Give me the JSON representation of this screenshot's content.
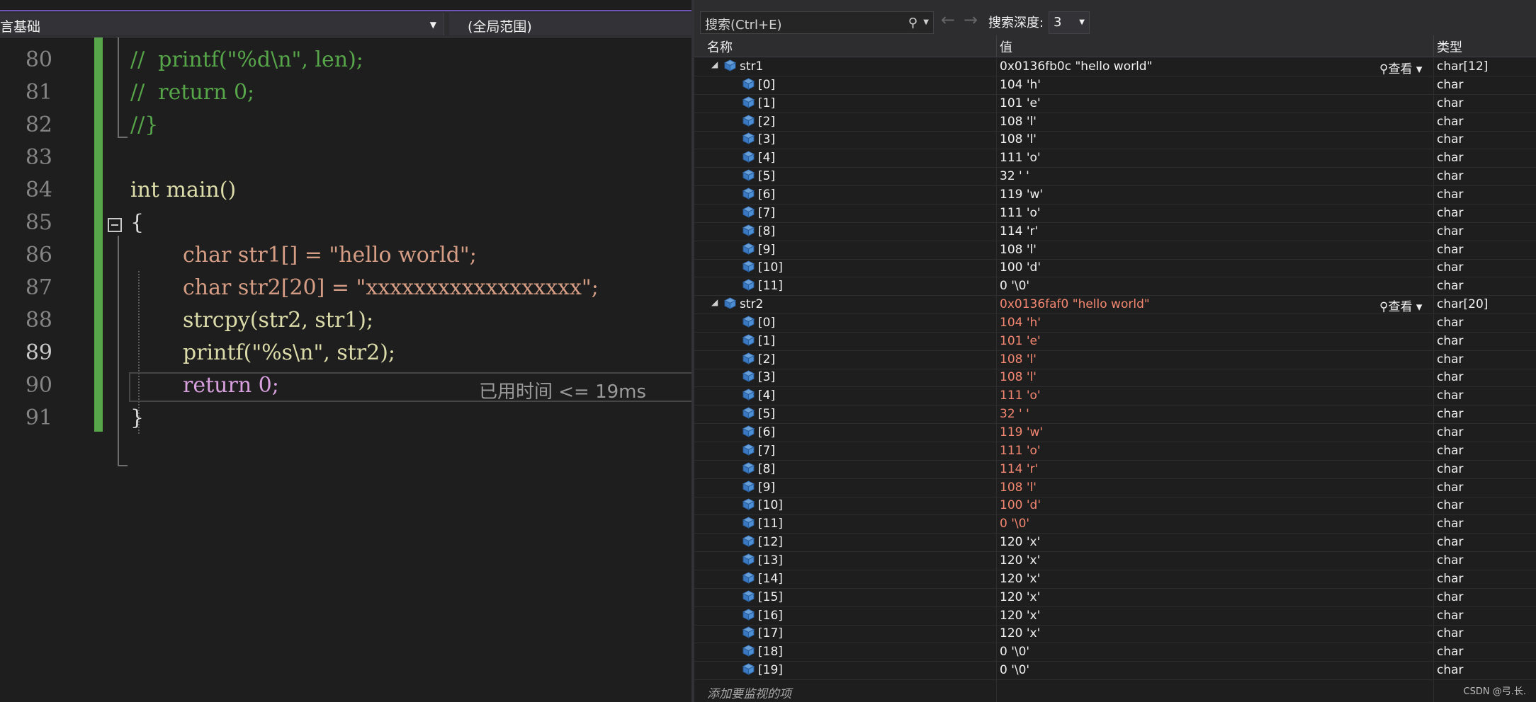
{
  "navbar": {
    "project": "言基础",
    "scope": "(全局范围)"
  },
  "editor": {
    "lines": [
      {
        "num": "80",
        "code": "//  printf(\"%d\\n\", len);"
      },
      {
        "num": "81",
        "code": "//  return 0;"
      },
      {
        "num": "82",
        "code": "//}"
      },
      {
        "num": "83",
        "code": ""
      },
      {
        "num": "84",
        "code": "int main()"
      },
      {
        "num": "85",
        "code": "{"
      },
      {
        "num": "86",
        "code": "char str1[] = \"hello world\";"
      },
      {
        "num": "87",
        "code": "char str2[20] = \"xxxxxxxxxxxxxxxxxx\";"
      },
      {
        "num": "88",
        "code": "strcpy(str2, str1);"
      },
      {
        "num": "89",
        "code": "printf(\"%s\\n\", str2);"
      },
      {
        "num": "90",
        "code": "return 0;"
      },
      {
        "num": "91",
        "code": "}"
      }
    ],
    "elapsed": "已用时间 <= 19ms"
  },
  "watch": {
    "search_placeholder": "搜索(Ctrl+E)",
    "depth_label": "搜索深度:",
    "depth_value": "3",
    "columns": {
      "name": "名称",
      "value": "值",
      "type": "类型"
    },
    "look_label": "查看",
    "add_item": "添加要监视的项",
    "rows": [
      {
        "name": "str1",
        "value": "0x0136fb0c \"hello world\"",
        "type": "char[12]",
        "level": 0,
        "changed": false
      },
      {
        "name": "[0]",
        "value": "104 'h'",
        "type": "char",
        "level": 1,
        "changed": false
      },
      {
        "name": "[1]",
        "value": "101 'e'",
        "type": "char",
        "level": 1,
        "changed": false
      },
      {
        "name": "[2]",
        "value": "108 'l'",
        "type": "char",
        "level": 1,
        "changed": false
      },
      {
        "name": "[3]",
        "value": "108 'l'",
        "type": "char",
        "level": 1,
        "changed": false
      },
      {
        "name": "[4]",
        "value": "111 'o'",
        "type": "char",
        "level": 1,
        "changed": false
      },
      {
        "name": "[5]",
        "value": "32 ' '",
        "type": "char",
        "level": 1,
        "changed": false
      },
      {
        "name": "[6]",
        "value": "119 'w'",
        "type": "char",
        "level": 1,
        "changed": false
      },
      {
        "name": "[7]",
        "value": "111 'o'",
        "type": "char",
        "level": 1,
        "changed": false
      },
      {
        "name": "[8]",
        "value": "114 'r'",
        "type": "char",
        "level": 1,
        "changed": false
      },
      {
        "name": "[9]",
        "value": "108 'l'",
        "type": "char",
        "level": 1,
        "changed": false
      },
      {
        "name": "[10]",
        "value": "100 'd'",
        "type": "char",
        "level": 1,
        "changed": false
      },
      {
        "name": "[11]",
        "value": "0 '\\0'",
        "type": "char",
        "level": 1,
        "changed": false
      },
      {
        "name": "str2",
        "value": "0x0136faf0 \"hello world\"",
        "type": "char[20]",
        "level": 0,
        "changed": true
      },
      {
        "name": "[0]",
        "value": "104 'h'",
        "type": "char",
        "level": 1,
        "changed": true
      },
      {
        "name": "[1]",
        "value": "101 'e'",
        "type": "char",
        "level": 1,
        "changed": true
      },
      {
        "name": "[2]",
        "value": "108 'l'",
        "type": "char",
        "level": 1,
        "changed": true
      },
      {
        "name": "[3]",
        "value": "108 'l'",
        "type": "char",
        "level": 1,
        "changed": true
      },
      {
        "name": "[4]",
        "value": "111 'o'",
        "type": "char",
        "level": 1,
        "changed": true
      },
      {
        "name": "[5]",
        "value": "32 ' '",
        "type": "char",
        "level": 1,
        "changed": true
      },
      {
        "name": "[6]",
        "value": "119 'w'",
        "type": "char",
        "level": 1,
        "changed": true
      },
      {
        "name": "[7]",
        "value": "111 'o'",
        "type": "char",
        "level": 1,
        "changed": true
      },
      {
        "name": "[8]",
        "value": "114 'r'",
        "type": "char",
        "level": 1,
        "changed": true
      },
      {
        "name": "[9]",
        "value": "108 'l'",
        "type": "char",
        "level": 1,
        "changed": true
      },
      {
        "name": "[10]",
        "value": "100 'd'",
        "type": "char",
        "level": 1,
        "changed": true
      },
      {
        "name": "[11]",
        "value": "0 '\\0'",
        "type": "char",
        "level": 1,
        "changed": true
      },
      {
        "name": "[12]",
        "value": "120 'x'",
        "type": "char",
        "level": 1,
        "changed": false
      },
      {
        "name": "[13]",
        "value": "120 'x'",
        "type": "char",
        "level": 1,
        "changed": false
      },
      {
        "name": "[14]",
        "value": "120 'x'",
        "type": "char",
        "level": 1,
        "changed": false
      },
      {
        "name": "[15]",
        "value": "120 'x'",
        "type": "char",
        "level": 1,
        "changed": false
      },
      {
        "name": "[16]",
        "value": "120 'x'",
        "type": "char",
        "level": 1,
        "changed": false
      },
      {
        "name": "[17]",
        "value": "120 'x'",
        "type": "char",
        "level": 1,
        "changed": false
      },
      {
        "name": "[18]",
        "value": "0 '\\0'",
        "type": "char",
        "level": 1,
        "changed": false
      },
      {
        "name": "[19]",
        "value": "0 '\\0'",
        "type": "char",
        "level": 1,
        "changed": false
      }
    ]
  },
  "watermark": "CSDN @弓.长.",
  "colors": {
    "accent": "#6e56b8",
    "changed_value": "#f48771",
    "gutter_green": "#57a64a"
  }
}
